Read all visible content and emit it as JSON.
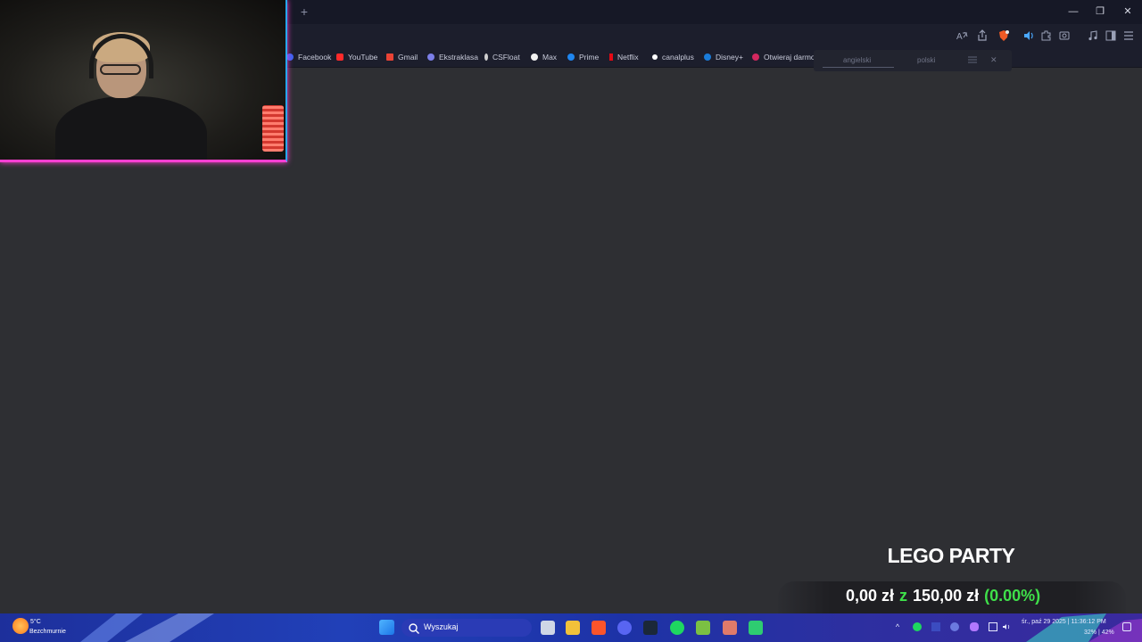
{
  "browser": {
    "new_tab_symbol": "+",
    "window_controls": {
      "minimize": "—",
      "maximize": "❐",
      "close": "✕"
    },
    "bookmarks": [
      {
        "label": "Facebook",
        "color": "#3b63f2"
      },
      {
        "label": "YouTube",
        "color": "#ff2a2a"
      },
      {
        "label": "Gmail",
        "color": "#ea4335"
      },
      {
        "label": "Ekstraklasa",
        "color": "#7c7fe8"
      },
      {
        "label": "CSFloat",
        "color": "#cfcfcf"
      },
      {
        "label": "Max",
        "color": "#f2f2f2"
      },
      {
        "label": "Prime",
        "color": "#1f86f0"
      },
      {
        "label": "Netflix",
        "color": "#e50914"
      },
      {
        "label": "canalplus",
        "color": "#ffffff"
      },
      {
        "label": "Disney+",
        "color": "#1a7cd9"
      },
      {
        "label": "Otwieraj darmowe s...",
        "color": "#d3285f"
      }
    ],
    "translate": {
      "tab_from": "angielski",
      "tab_to": "polski",
      "close": "✕"
    }
  },
  "overlay": {
    "goal_title": "LEGO PARTY",
    "goal_current": "0,00 zł",
    "goal_sep": "z",
    "goal_target": "150,00 zł",
    "goal_percent": "(0.00%)",
    "goal_fraction": 0.0,
    "accent_green": "#3fe04a"
  },
  "taskbar": {
    "weather_temp": "5°C",
    "weather_desc": "Bezchmurnie",
    "search_placeholder": "Wyszukaj",
    "clock_date": "śr., paź 29 2025 | 11:36:12 PM",
    "clock_stats": "32% | 42%"
  }
}
